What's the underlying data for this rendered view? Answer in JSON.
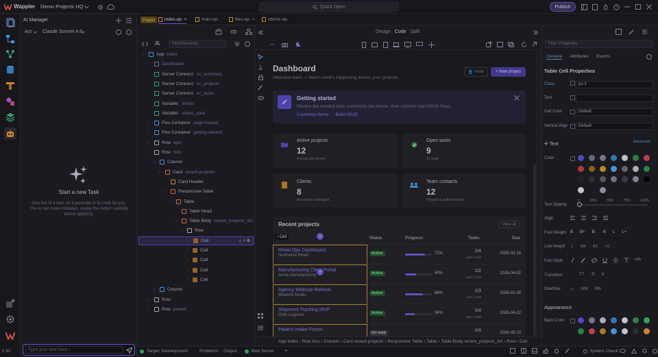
{
  "app": {
    "name": "Wappler",
    "project": "Demo Projects HQ",
    "quick_open": "Quick Open",
    "publish": "Publish"
  },
  "ai": {
    "title": "AI Manager",
    "mode": "Act",
    "model": "Claude Sonnet 4.6",
    "empty_title": "Start a new Task",
    "empty_desc": "Give the AI a task, let it generate or fix code for you. The AI can make mistakes, review the output carefully before applying.",
    "input_placeholder": "Type your task here..."
  },
  "tabs": [
    {
      "label": "Pages",
      "type": "badge"
    },
    {
      "label": "index.ejs"
    },
    {
      "label": "main.ejs"
    },
    {
      "label": "files.ejs"
    },
    {
      "label": "clients.ejs"
    }
  ],
  "structure": {
    "find_placeholder": "Find Elements",
    "items": [
      {
        "label": "App",
        "suffix": "index",
        "indent": 0,
        "icon": "app"
      },
      {
        "label": "Dashboard",
        "suffix": "",
        "indent": 1,
        "icon": "page",
        "muted": true
      },
      {
        "label": "Server Connect:",
        "suffix": "sc_summary",
        "indent": 1,
        "icon": "server"
      },
      {
        "label": "Server Connect:",
        "suffix": "sc_projects",
        "indent": 1,
        "icon": "server"
      },
      {
        "label": "Server Connect:",
        "suffix": "sc_tasks",
        "indent": 1,
        "icon": "server"
      },
      {
        "label": "Variable:",
        "suffix": "trends",
        "indent": 1,
        "icon": "var"
      },
      {
        "label": "Variable:",
        "suffix": "status_data",
        "indent": 1,
        "icon": "var"
      },
      {
        "label": "Flex Container",
        "suffix": "page-header",
        "indent": 1,
        "icon": "flex"
      },
      {
        "label": "Flex Container",
        "suffix": "getting-started",
        "indent": 1,
        "icon": "flex"
      },
      {
        "label": "Row",
        "suffix": "kpis",
        "indent": 1,
        "icon": "row"
      },
      {
        "label": "Row",
        "suffix": "lists",
        "indent": 1,
        "icon": "row"
      },
      {
        "label": "Column",
        "suffix": "",
        "indent": 2,
        "icon": "col"
      },
      {
        "label": "Card",
        "suffix": "recent-projects",
        "indent": 3,
        "icon": "card"
      },
      {
        "label": "Card Header",
        "suffix": "",
        "indent": 4,
        "icon": "cardh"
      },
      {
        "label": "Responsive Table",
        "suffix": "",
        "indent": 4,
        "icon": "table"
      },
      {
        "label": "Table",
        "suffix": "",
        "indent": 5,
        "icon": "table"
      },
      {
        "label": "Table Head",
        "suffix": "",
        "indent": 6,
        "icon": "thead"
      },
      {
        "label": "Table Body",
        "suffix": "recent_projects_list",
        "indent": 6,
        "icon": "thead"
      },
      {
        "label": "Row",
        "suffix": "",
        "indent": 7,
        "icon": "row"
      },
      {
        "label": "Cell",
        "suffix": "",
        "indent": 8,
        "icon": "cell",
        "selected": true
      },
      {
        "label": "Cell",
        "suffix": "",
        "indent": 8,
        "icon": "cell"
      },
      {
        "label": "Cell",
        "suffix": "",
        "indent": 8,
        "icon": "cell"
      },
      {
        "label": "Cell",
        "suffix": "",
        "indent": 8,
        "icon": "cell"
      },
      {
        "label": "Cell",
        "suffix": "",
        "indent": 8,
        "icon": "cell"
      },
      {
        "label": "Column",
        "suffix": "",
        "indent": 2,
        "icon": "col"
      },
      {
        "label": "Row",
        "suffix": "",
        "indent": 1,
        "icon": "row"
      },
      {
        "label": "Row",
        "suffix": "panels",
        "indent": 1,
        "icon": "row"
      }
    ]
  },
  "canvas": {
    "modes": [
      "Design",
      "Code",
      "Split"
    ],
    "active_mode": "Code"
  },
  "dashboard": {
    "title": "Dashboard",
    "subtitle": "Welcome back — here's what's happening across your projects.",
    "btn_invite": "Invite",
    "btn_new": "+ New project",
    "getting": {
      "title": "Getting started",
      "desc": "Review the seeded data, customize the theme, then connect real CRUD flows.",
      "link1": "Customize theme",
      "link2": "Build CRUD"
    },
    "stats": [
      {
        "label": "Active projects",
        "value": "12",
        "sub": "Across all clients"
      },
      {
        "label": "Open tasks",
        "value": "9",
        "sub": "11 total"
      },
      {
        "label": "Clients",
        "value": "8",
        "sub": "Accounts managed"
      },
      {
        "label": "Team contacts",
        "value": "12",
        "sub": "People & stakeholders"
      }
    ],
    "recent": {
      "title": "Recent projects",
      "view_all": "View all",
      "columns": [
        "Cell",
        "Status",
        "Progress",
        "Tasks",
        "Due"
      ],
      "rows": [
        {
          "name": "Retail Ops Dashboard",
          "client": "Northwind Retail",
          "status": "Active",
          "progress": 72,
          "tasks": "2/4",
          "tasks_sub": "open / total",
          "due": "2026-03-18"
        },
        {
          "name": "Manufacturing Client Portal",
          "client": "Acme Manufacturing",
          "status": "Active",
          "progress": 40,
          "tasks": "2/2",
          "tasks_sub": "open / total",
          "due": "2026-04-02"
        },
        {
          "name": "Agency Website Refresh",
          "client": "Bluebird Studio",
          "status": "Active",
          "progress": 66,
          "tasks": "2/3",
          "tasks_sub": "open / total",
          "due": "2026-02-28"
        },
        {
          "name": "Shipment Tracking MVP",
          "client": "Orbit Logistics",
          "status": "Active",
          "progress": 34,
          "tasks": "0/0",
          "tasks_sub": "open / total",
          "due": "2026-04-22"
        },
        {
          "name": "Patient Intake Forms",
          "client": "",
          "status": "On hold",
          "progress": 0,
          "tasks": "0/0",
          "tasks_sub": "",
          "due": "2026-05-10"
        }
      ]
    }
  },
  "breadcrumb": [
    "App",
    "index",
    "Row",
    "lists",
    "Column",
    "Card",
    "recent-projects",
    "Responsive Table",
    "Table",
    "Table Body",
    "recent_projects_list",
    "Row",
    "Cell"
  ],
  "breadcrumb_text": "App index › Row lists › Column › Card recent-projects › Responsive Table › Table › Table Body recent_projects_list › Row › Cell",
  "props": {
    "filter_placeholder": "Filter Properties",
    "tabs": [
      "General",
      "Attributes",
      "Events"
    ],
    "section_title": "Table Cell Properties",
    "class_label": "Class",
    "class_value": "ps-3",
    "text_label": "Text",
    "cell_color_label": "Cell Color",
    "cell_color_value": "Default",
    "valign_label": "Vertical Align",
    "valign_value": "Default",
    "text_section": "Text",
    "advanced": "Advanced",
    "color_label": "Color",
    "opacity_label": "Text Opacity",
    "opacity_ticks": [
      "0",
      "25%",
      "50%",
      "75%",
      "100%"
    ],
    "align_label": "Align",
    "weight_label": "Font Weight",
    "weights": [
      "B",
      "B+",
      "B-",
      "N",
      "L",
      "L+"
    ],
    "line_height_label": "Line Height",
    "line_heights": [
      "1",
      "SM",
      "BS",
      "LG"
    ],
    "font_style_label": "Font Style",
    "font_style_na": "N/A",
    "transform_label": "Transform",
    "transforms": [
      "TT",
      "Tt",
      "tt"
    ],
    "overflow_label": "Overflow",
    "overflows": [
      "NW",
      "Wb"
    ],
    "appearance": "Appearance",
    "back_color_label": "Back Color"
  },
  "status": {
    "counter": "1:92",
    "target": "Target: Development",
    "problems": "Problems",
    "output": "Output",
    "web_server": "Web Server",
    "system_check": "System Check"
  },
  "colors": {
    "accent": "#6f5fe0",
    "active_green": "#8fe49e",
    "purple_ui": "#7b66ff"
  }
}
